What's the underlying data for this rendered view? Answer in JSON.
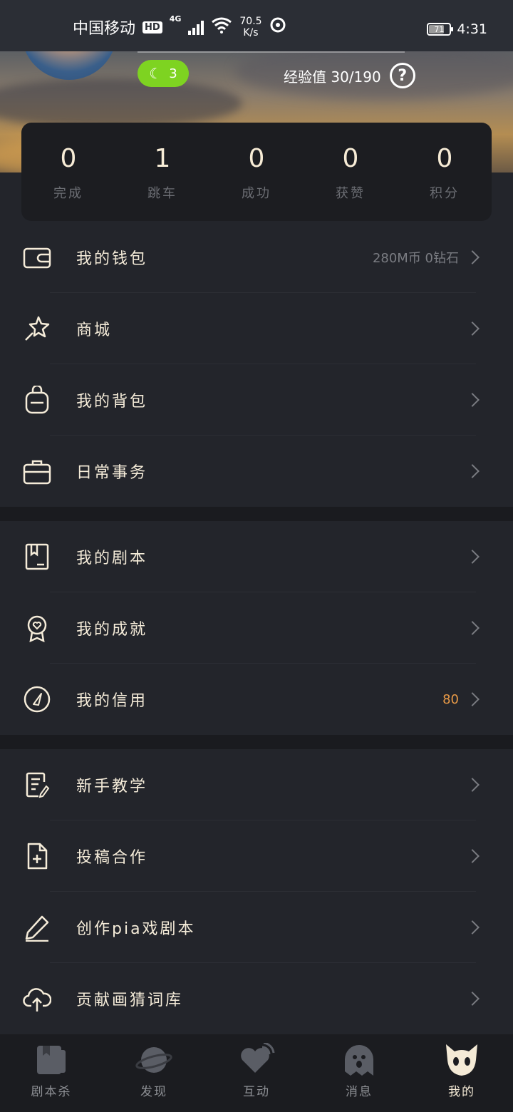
{
  "status_bar": {
    "carrier": "中国移动",
    "hd": "HD",
    "network": "4G",
    "speed_value": "70.5",
    "speed_unit": "K/s",
    "battery": "71",
    "time": "4:31"
  },
  "profile": {
    "level": "3",
    "exp_label": "经验值 30/190"
  },
  "stats": [
    {
      "value": "0",
      "label": "完成"
    },
    {
      "value": "1",
      "label": "跳车"
    },
    {
      "value": "0",
      "label": "成功"
    },
    {
      "value": "0",
      "label": "获赞"
    },
    {
      "value": "0",
      "label": "积分"
    }
  ],
  "menu": {
    "group1": [
      {
        "label": "我的钱包",
        "value": "280M币 0钻石",
        "icon": "wallet-icon"
      },
      {
        "label": "商城",
        "value": "",
        "icon": "star-wand-icon"
      },
      {
        "label": "我的背包",
        "value": "",
        "icon": "backpack-icon"
      },
      {
        "label": "日常事务",
        "value": "",
        "icon": "briefcase-icon"
      }
    ],
    "group2": [
      {
        "label": "我的剧本",
        "value": "",
        "icon": "script-book-icon"
      },
      {
        "label": "我的成就",
        "value": "",
        "icon": "medal-icon"
      },
      {
        "label": "我的信用",
        "value": "80",
        "icon": "gauge-icon"
      }
    ],
    "group3": [
      {
        "label": "新手教学",
        "value": "",
        "icon": "document-edit-icon"
      },
      {
        "label": "投稿合作",
        "value": "",
        "icon": "file-plus-icon"
      },
      {
        "label": "创作pia戏剧本",
        "value": "",
        "icon": "pencil-icon"
      },
      {
        "label": "贡献画猜词库",
        "value": "",
        "icon": "cloud-upload-icon"
      }
    ]
  },
  "tabs": [
    {
      "label": "剧本杀",
      "icon": "script-book-tab-icon"
    },
    {
      "label": "发现",
      "icon": "planet-icon"
    },
    {
      "label": "互动",
      "icon": "heart-signal-icon"
    },
    {
      "label": "消息",
      "icon": "ghost-chat-icon"
    },
    {
      "label": "我的",
      "icon": "cat-face-icon"
    }
  ],
  "colors": {
    "accent": "#f5ecd9",
    "badge_green": "#7ed321",
    "credit_orange": "#e89a47",
    "background": "#23252b"
  }
}
